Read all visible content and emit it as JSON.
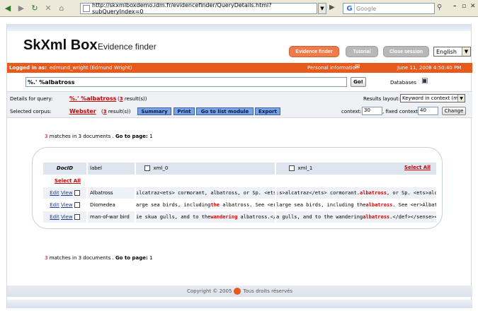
{
  "browser": {
    "url": "http://skxmlboxdemo.idm.fr/evidencefinder/QueryDetails.html?subQueryIndex=0",
    "search_placeholder": "Google"
  },
  "header": {
    "brand": "SkXml Box",
    "subtitle": "Evidence finder",
    "nav": [
      "Evidence finder",
      "Tutorial",
      "Close session"
    ],
    "language": "English"
  },
  "userbar": {
    "logged_label": "Logged in as:",
    "user": "edmund_wright (Edmund Wright)",
    "personal_info": "Personal information",
    "date": "June 11, 2008 4:50:40 PM"
  },
  "query": {
    "value": "%.' %albatross",
    "go_label": "Go!",
    "databases_label": "Databases"
  },
  "details": {
    "details_label": "Details for query:",
    "query_link": "%.' %albatross",
    "count_open": "(",
    "count": "3",
    "count_close": " result(s))",
    "corpus_label": "Selected corpus:",
    "corpus_link": "Webster",
    "corpus_count": "3",
    "buttons": [
      "Summary",
      "Print",
      "Go to list module",
      "Export"
    ],
    "layout_label": "Results layout:",
    "layout_value": "Keyword in context (mo",
    "context_label": "context:",
    "context_value": "30",
    "fixed_label": ", fixed context:",
    "fixed_value": "40",
    "change_label": "Change"
  },
  "matches": {
    "count": "3",
    "text": " matches in 3 documents . ",
    "goto_label": "Go to page:",
    "page": "1"
  },
  "table": {
    "headers": [
      "DocID",
      "label",
      "xml_0",
      "xml_1"
    ],
    "select_all": "Select All",
    "edit": "Edit",
    "view": "View",
    "rows": [
      {
        "label": "Albatross",
        "xml0_pre": "ılcatraz<ets> cormorant, albatross, or Sp. <ets>",
        "xml1_pre": ":s>alcatraz</ets> cormorant.",
        "xml1_hl": "albatross",
        "xml1_post": ", or Sp. <ets>alcatr"
      },
      {
        "label": "Diomedea",
        "xml0_pre": "arge sea birds, including",
        "xml0_hl": "the",
        "xml0_post": " albatross. See <er>A",
        "xml1_pre": "large sea birds, including the",
        "xml1_hl": "albatross",
        "xml1_post": ". See <er>Albatross"
      },
      {
        "label": "man-of-war bird",
        "xml0_pre": "ie skua gulls, and to the",
        "xml0_hl": "wandering",
        "xml0_post": " albatross.</d",
        "xml1_pre": "a gulls, and to the wandering",
        "xml1_hl": "albatross",
        "xml1_post": ".</def></sense></"
      }
    ]
  },
  "footer": {
    "copyright": "Copyright © 2005",
    "rights": "Tous droits réservés"
  }
}
